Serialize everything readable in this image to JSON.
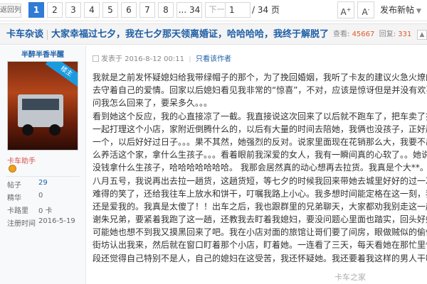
{
  "topbar": {
    "back_label": "返回列表",
    "pages": [
      "1",
      "2",
      "3",
      "4",
      "5",
      "6",
      "7",
      "8",
      "... 34"
    ],
    "current_page": "1",
    "next_label": "下一页",
    "page_input": "1",
    "page_total": "/ 34 页",
    "font_up": "A",
    "font_down": "A",
    "reply_label": "发布新帖"
  },
  "thread": {
    "forum": "卡车杂谈",
    "title": "大家幸福过七夕，我在七夕那天领离婚证，哈哈哈哈，我终于解脱了",
    "views_label": "查看:",
    "views": "45667",
    "replies_label": "回复:",
    "replies": "331"
  },
  "user": {
    "name": "半醉半香半醒",
    "badge": "楼主",
    "role": "卡车助手",
    "stats": [
      {
        "label": "帖子",
        "value": "29"
      },
      {
        "label": "精华",
        "value": "0"
      },
      {
        "label": "卡路里",
        "value": "0 卡"
      },
      {
        "label": "注册时间",
        "value": "2016-5-19"
      }
    ]
  },
  "post": {
    "posted_on": "发表于 2016-8-12 00:11",
    "only_author": "只看该作者",
    "lines": [
      "我就是之前发怀疑媳妇给我带绿帽子的那个，为了挽回婚姻，我听了卡友的建议火急火燎的赶了回来",
      "去守着自己的爱情。回家以后媳妇看见我非常的“惊喜”，不对，应该是惊讶但是并没有欢喜。一个",
      "问我怎么回来了，要呆多久。。。",
      "看到她这个反应，我的心直接凉了一截。我直接说这次回来了以后就不跑车了，把车卖了换辆轻卡，",
      "一起打理这个小店，家附近倒腾什么的，以后有大量的时间去陪她，我俩也没孩子，正好趁这个机",
      "一个，以后好好过日子。。。果不其然，她强烈的反对。说家里面现在花销那么大，我要不出去跑车",
      "么养活这个家，拿什么生孩子。。。看着眼前我深爱的女人，我有一瞬间真的心软了。。她说的也没",
      "没钱拿什么生孩子，哈哈哈哈哈哈哈。    我那会居然真的动心想再去拉货。我真是个大**。",
      "八月五号，我说再出去拉一趟货，这趟货短，等七夕的时候我回来带她去城里好好的过一次七夕。当",
      "难得的笑了，还给我往车上放水和饼干，叮嘱我路上小心。我多想时间能定格在这一刻，我觉得那时",
      "还是爱我的。我真是太傻了！！出车之后，我也跟群里的兄弟聊天，大家都劝我别走这一趟。在这里",
      "谢朱兄弟，要紧着我跑了这一趟，还教我去盯着我媳妇，要没问题心里面也踏实，回头好好过日子。",
      "可能她也想不到我又摸黑回来了吧。我在小店对面的旅馆让哥们要了间房，眼做贼似的偷偷的上楼，",
      "街坊认出我来，然后就在窗口盯着那个小店，盯着她。一连看了三天，每天看她在那忙里忙外的，我",
      "段还觉得自己特别不是人，自己的媳妇在这受苦，我还怀疑她。我还要着我这样的男人干啥，"
    ]
  },
  "watermark": "卡车之家"
}
